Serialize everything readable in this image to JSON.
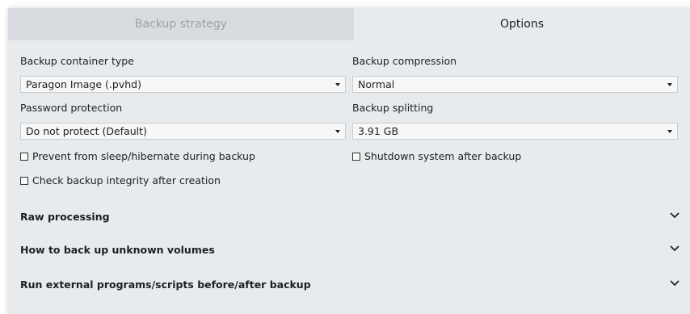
{
  "tabs": [
    {
      "label": "Backup strategy",
      "active": false
    },
    {
      "label": "Options",
      "active": true
    }
  ],
  "left": {
    "container_type": {
      "label": "Backup container type",
      "value": "Paragon Image (.pvhd)"
    },
    "password": {
      "label": "Password protection",
      "value": "Do not protect (Default)"
    },
    "prevent_sleep": {
      "label": "Prevent from sleep/hibernate during backup",
      "checked": false
    },
    "check_integrity": {
      "label": "Check backup integrity after creation",
      "checked": false
    }
  },
  "right": {
    "compression": {
      "label": "Backup compression",
      "value": "Normal"
    },
    "splitting": {
      "label": "Backup splitting",
      "value": "3.91 GB"
    },
    "shutdown": {
      "label": "Shutdown system after backup",
      "checked": false
    }
  },
  "sections": [
    {
      "title": "Raw processing",
      "icon": "chevron-down-icon"
    },
    {
      "title": "How to back up unknown volumes",
      "icon": "chevron-down-icon"
    },
    {
      "title": "Run external programs/scripts before/after backup",
      "icon": "chevron-down-icon"
    }
  ],
  "colors": {
    "panel_bg": "#e7ebee",
    "inactive_tab_bg": "#d8dce0",
    "inactive_tab_text": "#9aa1a7"
  }
}
